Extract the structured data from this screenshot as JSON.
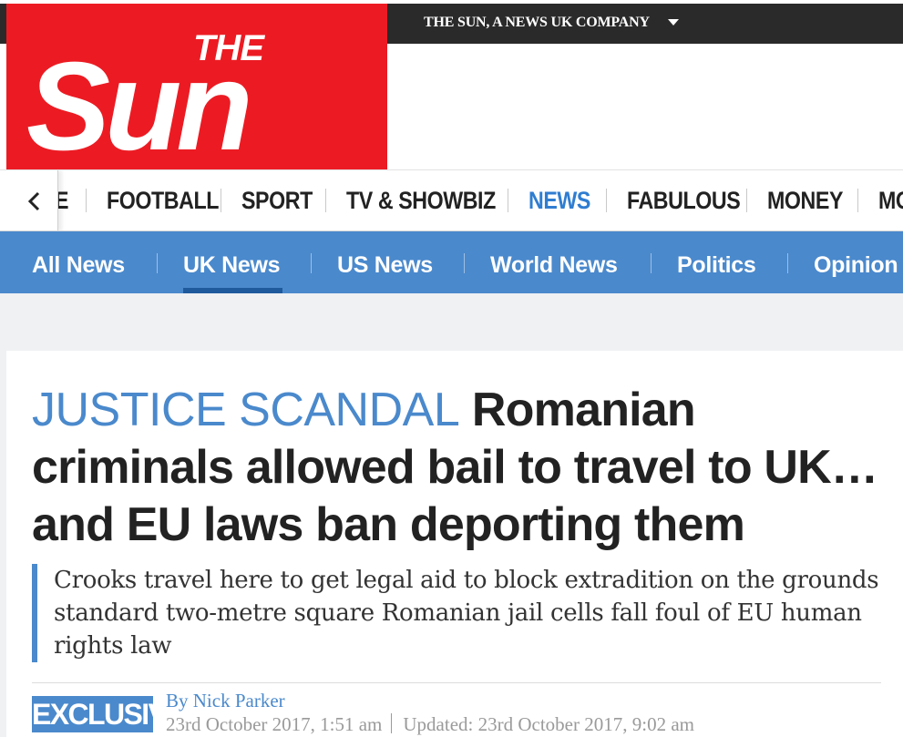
{
  "brand": {
    "logo_word_top": "THE",
    "logo_word_main": "Sun",
    "company_label": "THE SUN, A NEWS UK COMPANY"
  },
  "primary_nav": {
    "items": [
      {
        "label": "E"
      },
      {
        "label": "FOOTBALL"
      },
      {
        "label": "SPORT"
      },
      {
        "label": "TV & SHOWBIZ"
      },
      {
        "label": "NEWS",
        "active": true
      },
      {
        "label": "FABULOUS"
      },
      {
        "label": "MONEY"
      },
      {
        "label": "MO"
      }
    ]
  },
  "secondary_nav": {
    "items": [
      {
        "label": "All News"
      },
      {
        "label": "UK News",
        "active": true
      },
      {
        "label": "US News"
      },
      {
        "label": "World News"
      },
      {
        "label": "Politics"
      },
      {
        "label": "Opinion"
      }
    ]
  },
  "article": {
    "kicker": "JUSTICE SCANDAL",
    "headline": "Romanian criminals allowed bail to travel to UK… and EU laws ban deporting them",
    "standfirst": "Crooks travel here to get legal aid to block extradition on the grounds standard two-metre square Romanian jail cells fall foul of EU human rights law",
    "badge": "EXCLUSIVE",
    "byline_prefix": "By",
    "author": "Nick Parker",
    "published": "23rd October 2017, 1:51 am",
    "updated": "Updated: 23rd October 2017, 9:02 am"
  },
  "colors": {
    "brand_red": "#ec1b23",
    "accent_blue": "#4a89cc",
    "dark_bar": "#2a2a2a"
  }
}
